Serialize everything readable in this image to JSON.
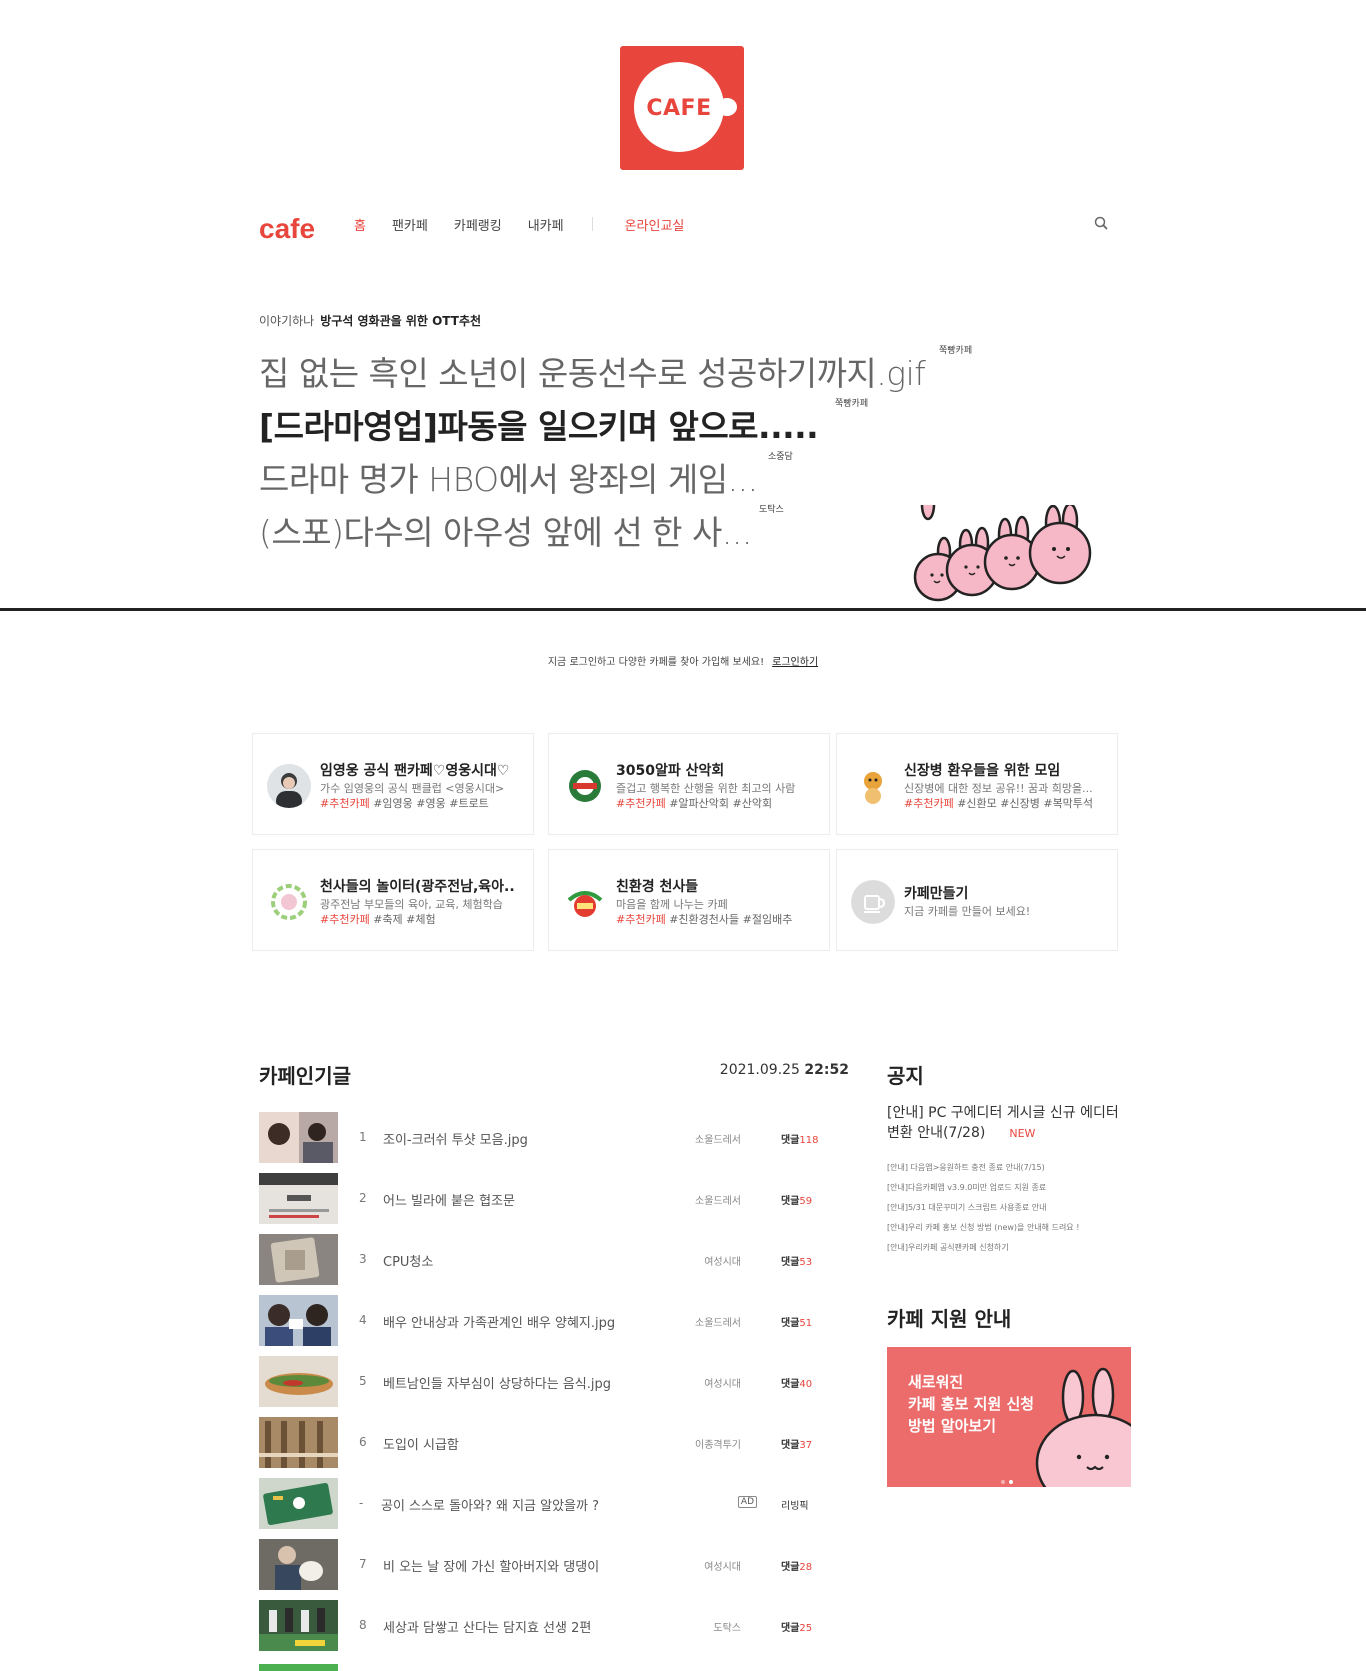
{
  "logo": {
    "text": "CAFE",
    "color": "#e8453c"
  },
  "gnb": {
    "brand": "cafe",
    "items": [
      {
        "label": "홈",
        "active": true
      },
      {
        "label": "팬카페"
      },
      {
        "label": "카페랭킹"
      },
      {
        "label": "내카페"
      }
    ],
    "online": "온라인교실",
    "search_icon": "search-icon"
  },
  "hero": {
    "category": "이야기하나",
    "category_title": "방구석 영화관을 위한 OTT추천",
    "stories": [
      {
        "title": "집 없는 흑인 소년이 운동선수로 성공하기까지.gif",
        "source": "쭉빵카페"
      },
      {
        "title": "[드라마영업]파동을 일으키며 앞으로.....",
        "source": "쭉빵카페"
      },
      {
        "title": "드라마 명가 HBO에서 왕좌의 게임...",
        "source": "소중담"
      },
      {
        "title": "(스포)다수의 아우성 앞에 선 한 사...",
        "source": "도탁스"
      }
    ]
  },
  "login": {
    "text": "지금 로그인하고 다양한 카페를 찾아 가입해 보세요!",
    "link": "로그인하기"
  },
  "cafes": [
    {
      "name": "임영웅 공식 팬카페♡영웅시대♡",
      "desc": "가수 임영웅의 공식 팬클럽 <영웅시대>",
      "rec": "#추천카페",
      "tags": "#임영웅 #영웅 #트로트"
    },
    {
      "name": "3050알파 산악회",
      "desc": "즐겁고 행복한 산행을 위한 최고의 사람",
      "rec": "#추천카페",
      "tags": "#알파산악회 #산악회"
    },
    {
      "name": "신장병 환우들을 위한 모임",
      "desc": "신장병에 대한 정보 공유!! 꿈과 희망을...",
      "rec": "#추천카페",
      "tags": "#신환모 #신장병 #복막투석"
    },
    {
      "name": "천사들의 놀이터(광주전남,육아..",
      "desc": "광주전남 부모들의 육아, 교육, 체험학습",
      "rec": "#추천카페",
      "tags": "#축제 #체험"
    },
    {
      "name": "친환경 천사들",
      "desc": "마음을 함께 나누는 카페",
      "rec": "#추천카페",
      "tags": "#친환경천사들 #절임배추"
    },
    {
      "name": "카페만들기",
      "desc": "지금 카페를 만들어 보세요!",
      "rec": "",
      "tags": ""
    }
  ],
  "popular": {
    "title": "카페인기글",
    "time": "2021.09.25",
    "clock": "22:52",
    "comment_label": "댓글",
    "rows": [
      {
        "num": "1",
        "title": "조이-크러쉬 투샷 모음.jpg",
        "source": "소울드레서",
        "comments": "118"
      },
      {
        "num": "2",
        "title": "어느 빌라에 붙은 협조문",
        "source": "소울드레서",
        "comments": "59"
      },
      {
        "num": "3",
        "title": "CPU청소",
        "source": "여성시대",
        "comments": "53"
      },
      {
        "num": "4",
        "title": "배우 안내상과 가족관계인 배우 양혜지.jpg",
        "source": "소울드레서",
        "comments": "51"
      },
      {
        "num": "5",
        "title": "베트남인들 자부심이 상당하다는 음식.jpg",
        "source": "여성시대",
        "comments": "40"
      },
      {
        "num": "6",
        "title": "도입이 시급함",
        "source": "이종격투기",
        "comments": "37"
      },
      {
        "num": "-",
        "title": "공이 스스로 돌아와? 왜 지금 알았을까 ?",
        "ad": "AD",
        "source": "리빙픽",
        "comments": ""
      },
      {
        "num": "7",
        "title": "비 오는 날 장에 가신 할아버지와 댕댕이",
        "source": "여성시대",
        "comments": "28"
      },
      {
        "num": "8",
        "title": "세상과 담쌓고 산다는 담지효 선생 2편",
        "source": "도탁스",
        "comments": "25"
      }
    ]
  },
  "notice": {
    "title": "공지",
    "main": "[안내] PC 구에디터 게시글 신규 에디터 변환 안내(7/28)",
    "new_label": "NEW",
    "items": [
      "[안내] 다음앱>응원하트 충전 종료 안내(7/15)",
      "[안내]다음카페앱 v3.9.0미만 업로드 지원 종료",
      "[안내]5/31 대문꾸미기 스크립트 사용종료 안내",
      "[안내]우리 카페 홍보 신청 방법 (new)을 안내해 드려요 !",
      "[안내]우리카페 공식팬카페 신청하기"
    ]
  },
  "support": {
    "title": "카페 지원 안내",
    "banner_lines": [
      "새로워진",
      "카페 홍보 지원 신청",
      "방법 알아보기"
    ]
  }
}
